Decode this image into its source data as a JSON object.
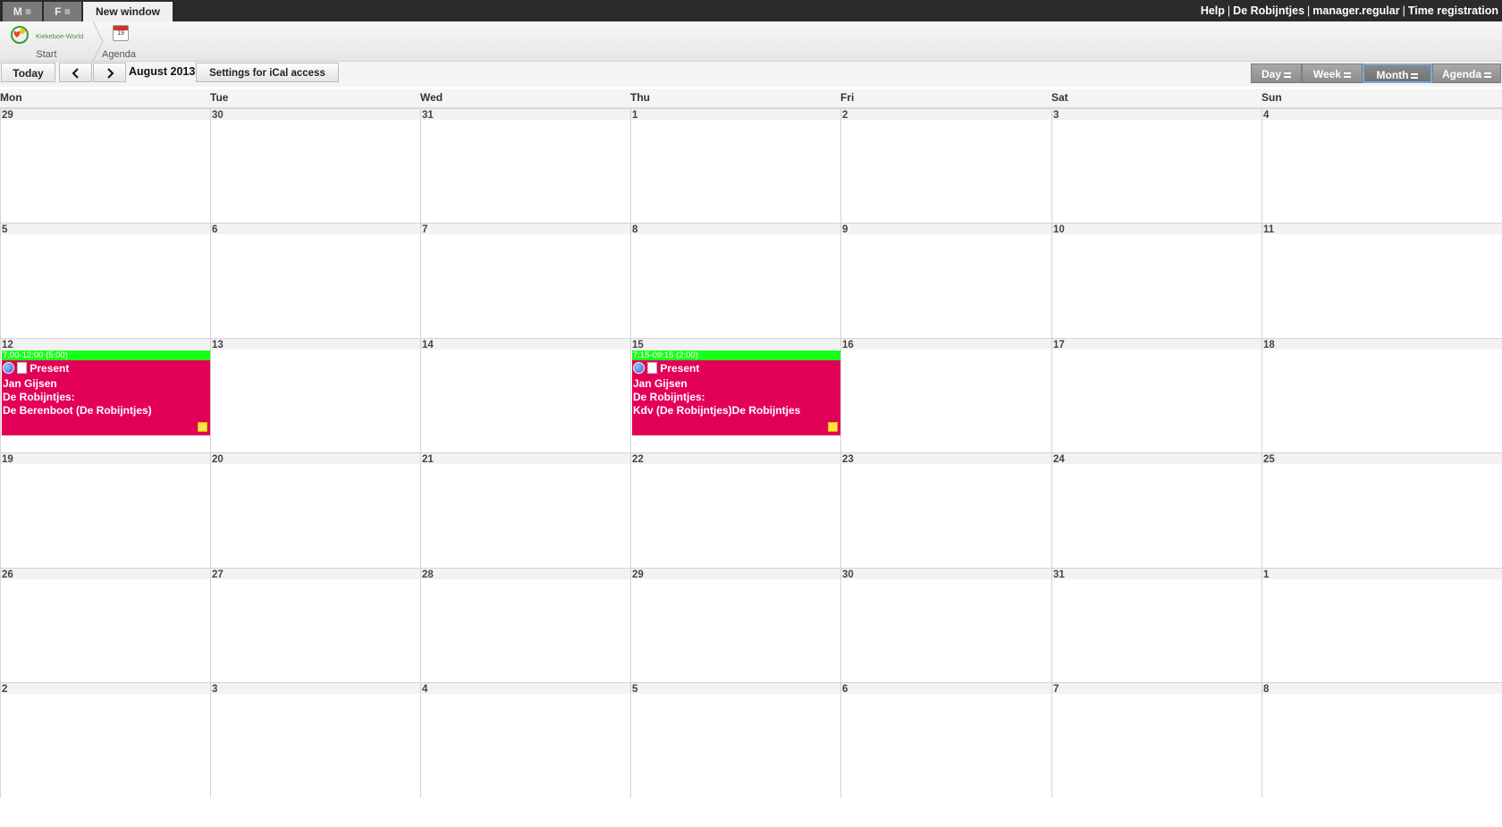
{
  "topbar": {
    "tabs": [
      {
        "label": "M ≡"
      },
      {
        "label": "F ≡"
      },
      {
        "label": "New window"
      }
    ],
    "links": [
      "Help",
      "De Robijntjes",
      "manager.regular",
      "Time registration"
    ]
  },
  "launcher": {
    "start_label": "Start",
    "logo_text": "Kiekeboe-World",
    "agenda_label": "Agenda",
    "agenda_icon_day": "19"
  },
  "toolbar": {
    "today": "Today",
    "prev_icon": "chevron-left-icon",
    "next_icon": "chevron-right-icon",
    "month": "August 2013",
    "ical": "Settings for iCal access",
    "views": [
      {
        "label": "Day",
        "active": false
      },
      {
        "label": "Week",
        "active": false
      },
      {
        "label": "Month",
        "active": true
      },
      {
        "label": "Agenda",
        "active": false
      }
    ]
  },
  "calendar": {
    "day_headers": [
      "Mon",
      "Tue",
      "Wed",
      "Thu",
      "Fri",
      "Sat",
      "Sun"
    ],
    "weeks": [
      [
        "29",
        "30",
        "31",
        "1",
        "2",
        "3",
        "4"
      ],
      [
        "5",
        "6",
        "7",
        "8",
        "9",
        "10",
        "11"
      ],
      [
        "12",
        "13",
        "14",
        "15",
        "16",
        "17",
        "18"
      ],
      [
        "19",
        "20",
        "21",
        "22",
        "23",
        "24",
        "25"
      ],
      [
        "26",
        "27",
        "28",
        "29",
        "30",
        "31",
        "1"
      ],
      [
        "2",
        "3",
        "4",
        "5",
        "6",
        "7",
        "8"
      ]
    ],
    "events": [
      {
        "time": "7:00-12:00 (5:00)",
        "title": "Present",
        "person": "Jan Gijsen",
        "location": "De Robijntjes:",
        "group": "De Berenboot (De Robijntjes)",
        "color": "#e30058",
        "time_color": "#19ff19"
      },
      {
        "time": "7:15-09:15 (2:00)",
        "title": "Present",
        "person": "Jan Gijsen",
        "location": "De Robijntjes:",
        "group": "Kdv (De Robijntjes)De Robijntjes",
        "color": "#e30058",
        "time_color": "#19ff19"
      }
    ]
  }
}
